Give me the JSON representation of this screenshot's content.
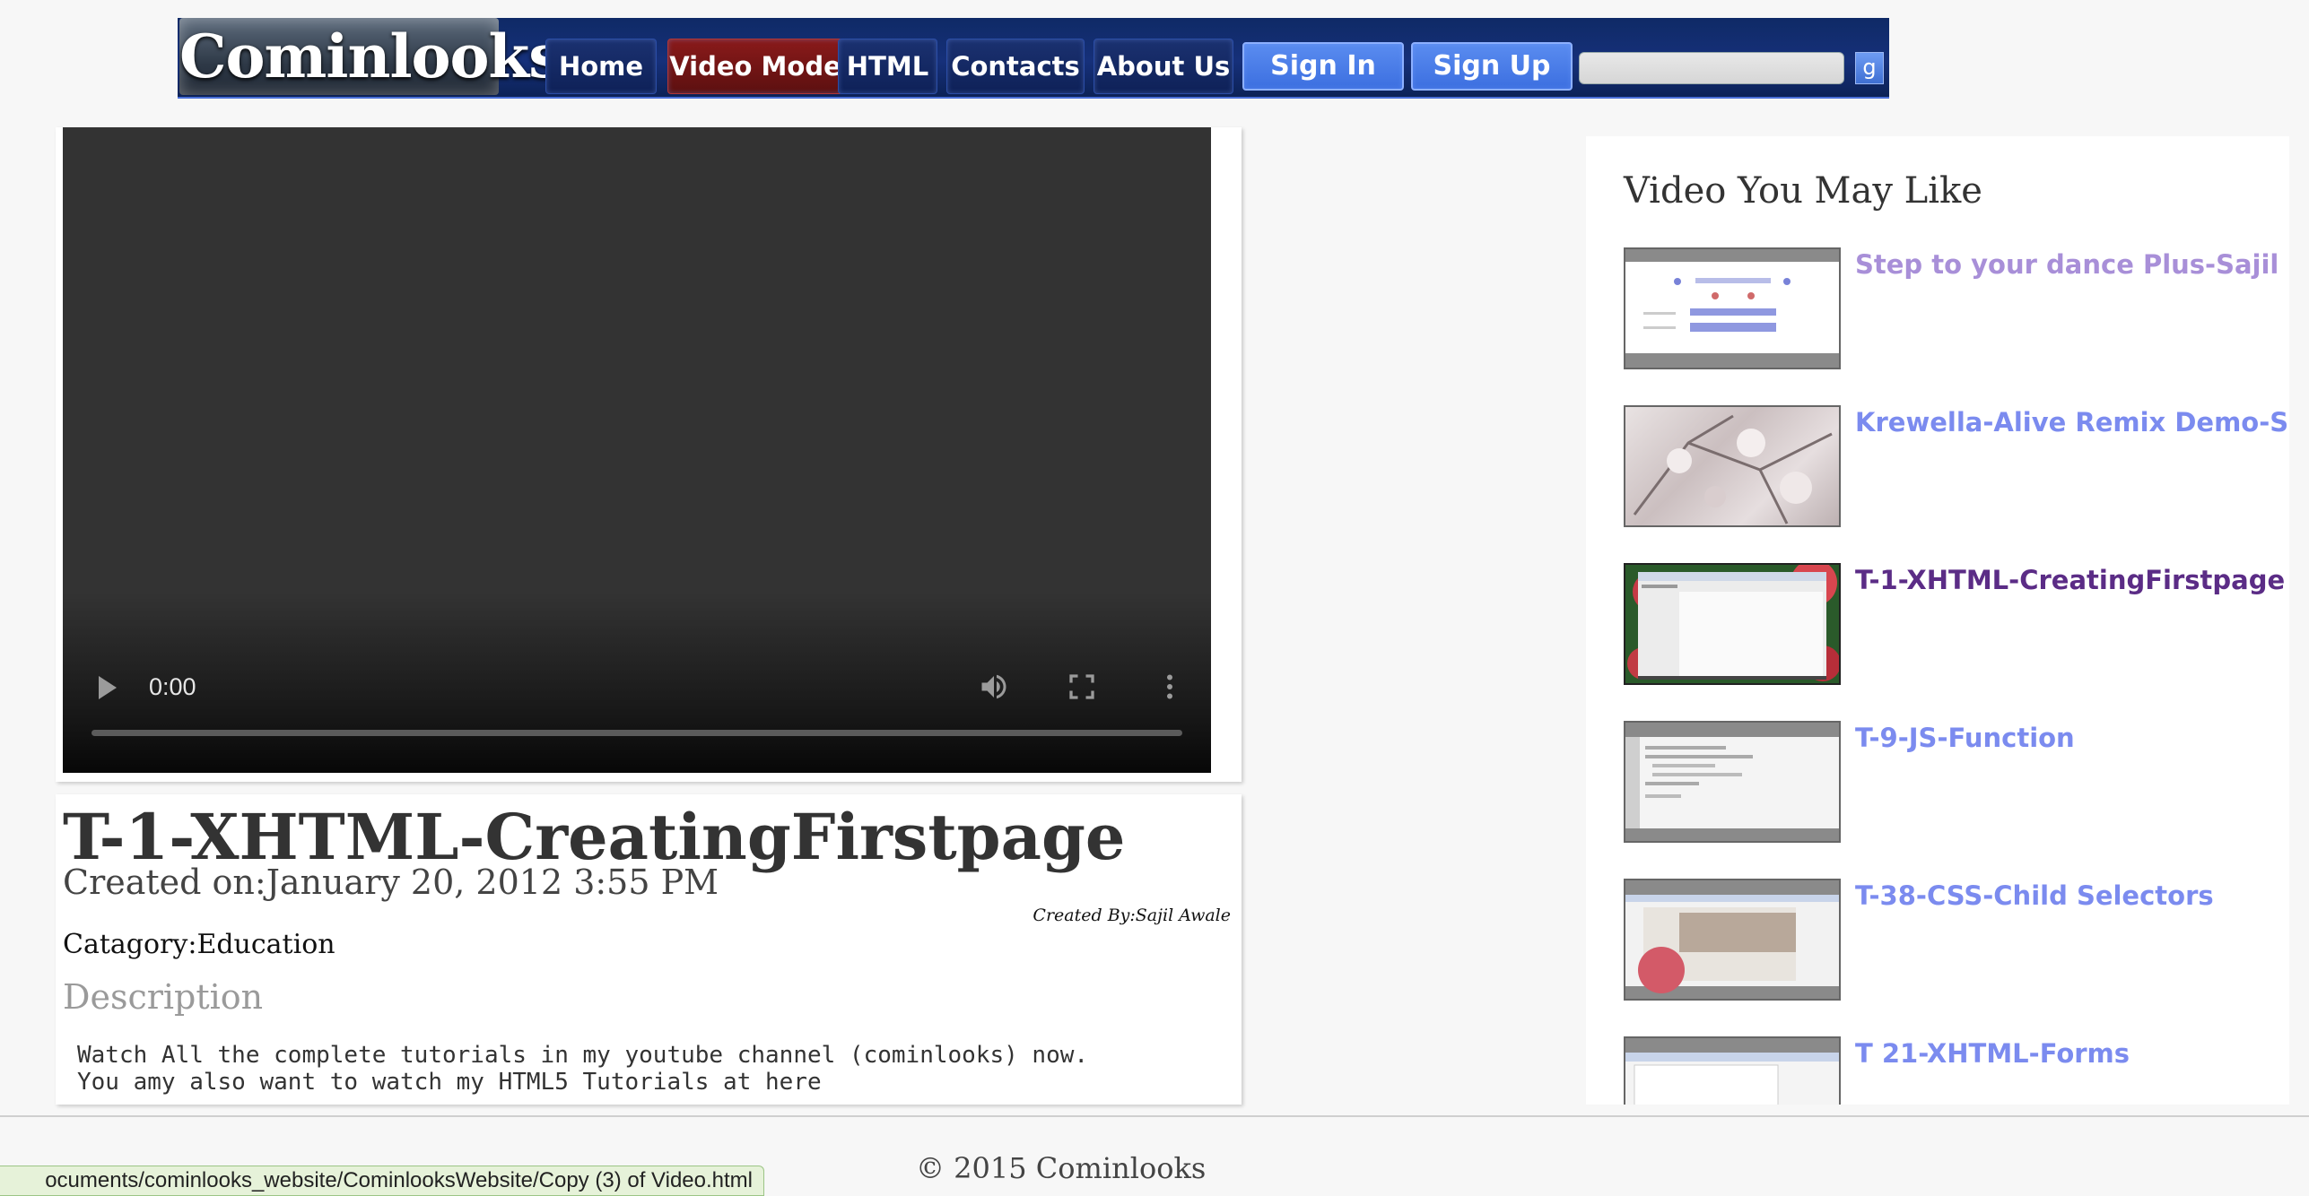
{
  "header": {
    "logo": "Cominlooks",
    "nav": [
      {
        "label": "Home"
      },
      {
        "label": "Video Mode"
      },
      {
        "label": "HTML"
      },
      {
        "label": "Contacts"
      },
      {
        "label": "About Us"
      }
    ],
    "sign_in": "Sign In",
    "sign_up": "Sign Up",
    "search": {
      "value": "",
      "button": "g"
    }
  },
  "player": {
    "time": "0:00",
    "progress": 0
  },
  "video": {
    "title": "T-1-XHTML-CreatingFirstpage",
    "created_on": "Created on:January 20, 2012 3:55 PM",
    "created_by": "Created By:Sajil Awale",
    "category": "Catagory:Education",
    "description_heading": "Description",
    "description_lines": [
      "Watch All the complete tutorials in my youtube channel (cominlooks) now.",
      "You amy also want to watch my HTML5 Tutorials at here"
    ]
  },
  "sidebar": {
    "title": "Video You May Like",
    "items": [
      {
        "title": "Step to your dance Plus-Sajil",
        "state": "visited"
      },
      {
        "title": "Krewella-Alive Remix Demo-Sajil",
        "state": "normal"
      },
      {
        "title": "T-1-XHTML-CreatingFirstpage",
        "state": "current"
      },
      {
        "title": "T-9-JS-Function",
        "state": "normal"
      },
      {
        "title": "T-38-CSS-Child Selectors",
        "state": "normal"
      },
      {
        "title": "T 21-XHTML-Forms",
        "state": "normal"
      }
    ]
  },
  "footer": {
    "text": "© 2015 Cominlooks"
  },
  "status_bar": {
    "text": "ocuments/cominlooks_website/CominlooksWebsite/Copy (3) of Video.html"
  },
  "colors": {
    "header_bg": "#16307a",
    "active_nav": "#8a1a1a",
    "auth_button": "#4a7ce8",
    "link": "#7b8bef",
    "link_visited": "#a88fd8",
    "link_current": "#5b2c86"
  }
}
